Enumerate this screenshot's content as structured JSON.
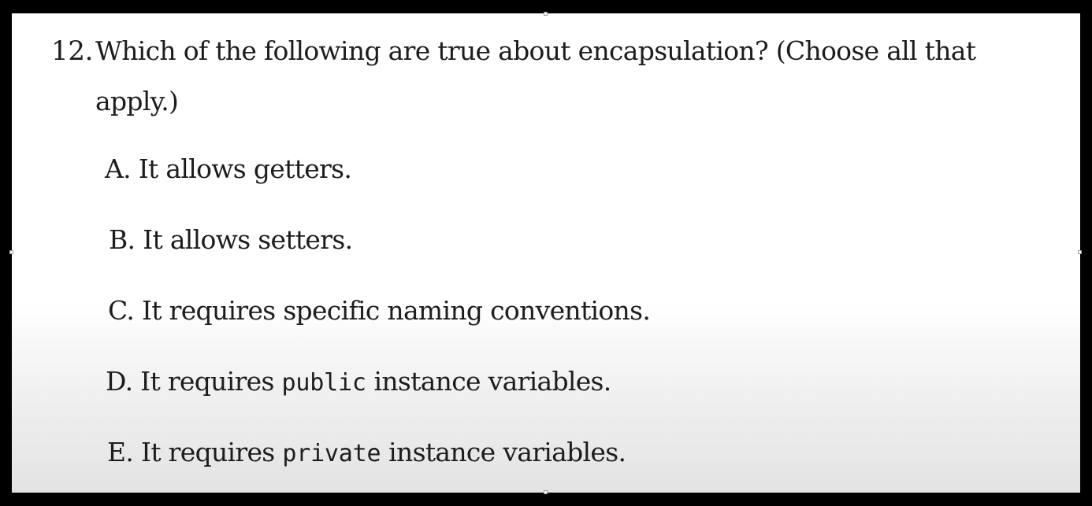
{
  "question": {
    "number": "12.",
    "text": "Which of the following are true about encapsulation? (Choose all that apply.)"
  },
  "options": [
    {
      "letter": "A.",
      "text": "It allows getters."
    },
    {
      "letter": "B.",
      "text": "It allows setters."
    },
    {
      "letter": "C.",
      "text": "It requires specific naming conventions."
    },
    {
      "letter": "D.",
      "text_before": "It requires",
      "code": "public",
      "text_after": "instance variables."
    },
    {
      "letter": "E.",
      "text_before": "It requires",
      "code": "private",
      "text_after": "instance variables."
    }
  ]
}
